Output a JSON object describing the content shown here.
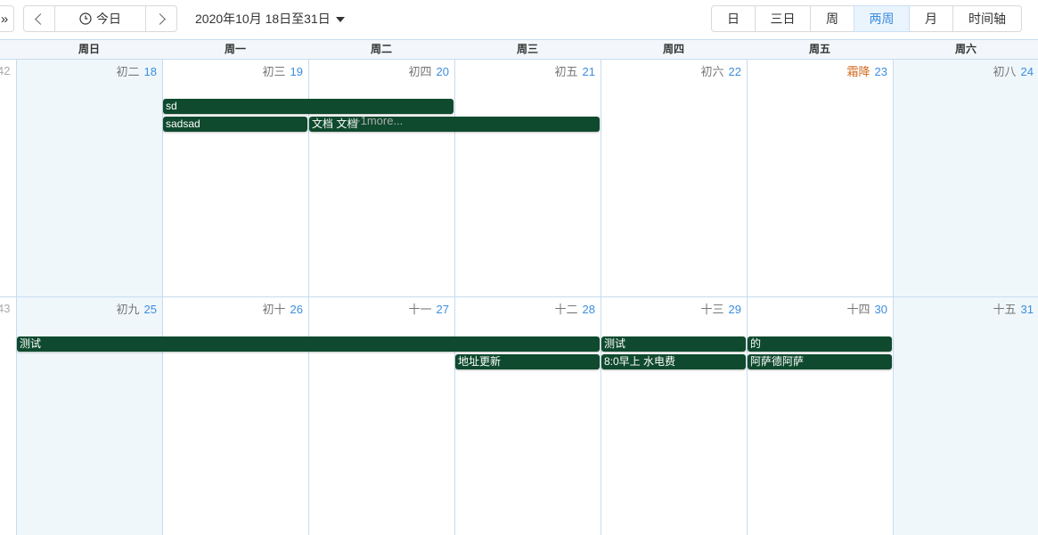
{
  "toolbar": {
    "expand_glyph": "»",
    "today_label": "今日",
    "range_label": "2020年10月 18日至31日",
    "views": [
      {
        "label": "日",
        "active": false
      },
      {
        "label": "三日",
        "active": false
      },
      {
        "label": "周",
        "active": false
      },
      {
        "label": "两周",
        "active": true
      },
      {
        "label": "月",
        "active": false
      },
      {
        "label": "时间轴",
        "active": false
      }
    ]
  },
  "colors": {
    "event_bg": "#0f4a2e",
    "accent": "#3c8dde",
    "weekend_bg": "#eff7fb",
    "solar_term": "#d2691e"
  },
  "weekdays": [
    "周日",
    "周一",
    "周二",
    "周三",
    "周四",
    "周五",
    "周六"
  ],
  "weeks": [
    {
      "week_number": "42",
      "days": [
        {
          "lunar": "初二",
          "day": "18"
        },
        {
          "lunar": "初三",
          "day": "19"
        },
        {
          "lunar": "初四",
          "day": "20"
        },
        {
          "lunar": "初五",
          "day": "21"
        },
        {
          "lunar": "初六",
          "day": "22"
        },
        {
          "lunar": "霜降",
          "day": "23",
          "solar_term": true
        },
        {
          "lunar": "初八",
          "day": "24"
        }
      ],
      "events": [
        {
          "title": "sd",
          "start": 1,
          "span": 2,
          "lane": 0
        },
        {
          "title": "sadsad",
          "start": 1,
          "span": 1,
          "lane": 1
        },
        {
          "title": "文档 文档",
          "start": 2,
          "span": 2,
          "lane": 1
        }
      ],
      "more": {
        "label": "+1more...",
        "col": 2
      }
    },
    {
      "week_number": "43",
      "days": [
        {
          "lunar": "初九",
          "day": "25"
        },
        {
          "lunar": "初十",
          "day": "26"
        },
        {
          "lunar": "十一",
          "day": "27"
        },
        {
          "lunar": "十二",
          "day": "28"
        },
        {
          "lunar": "十三",
          "day": "29"
        },
        {
          "lunar": "十四",
          "day": "30"
        },
        {
          "lunar": "十五",
          "day": "31"
        }
      ],
      "events": [
        {
          "title": "测试",
          "start": 0,
          "span": 4,
          "lane": 0
        },
        {
          "title": "测试",
          "start": 4,
          "span": 1,
          "lane": 0
        },
        {
          "title": "的",
          "start": 5,
          "span": 1,
          "lane": 0
        },
        {
          "title": "地址更新",
          "start": 3,
          "span": 1,
          "lane": 1
        },
        {
          "title": "8:0早上 水电费",
          "start": 4,
          "span": 1,
          "lane": 1
        },
        {
          "title": "阿萨德阿萨",
          "start": 5,
          "span": 1,
          "lane": 1
        }
      ]
    }
  ]
}
